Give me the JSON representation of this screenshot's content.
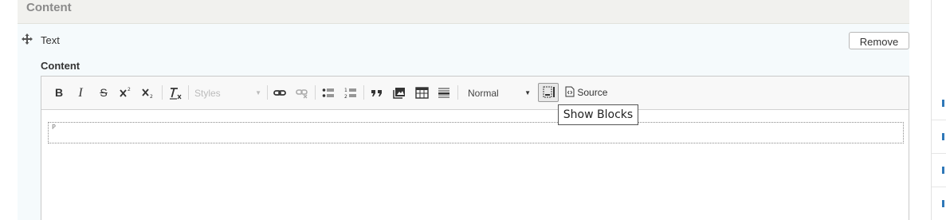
{
  "section": {
    "title": "Content"
  },
  "paragraph": {
    "type_label": "Text",
    "remove_label": "Remove"
  },
  "field": {
    "label": "Content"
  },
  "toolbar": {
    "styles_label": "Styles",
    "format_label": "Normal",
    "source_label": "Source",
    "buttons": {
      "bold": "B",
      "italic": "I",
      "strike": "S"
    }
  },
  "tooltip": {
    "text": "Show Blocks"
  },
  "editor": {
    "block_tag": "P"
  }
}
